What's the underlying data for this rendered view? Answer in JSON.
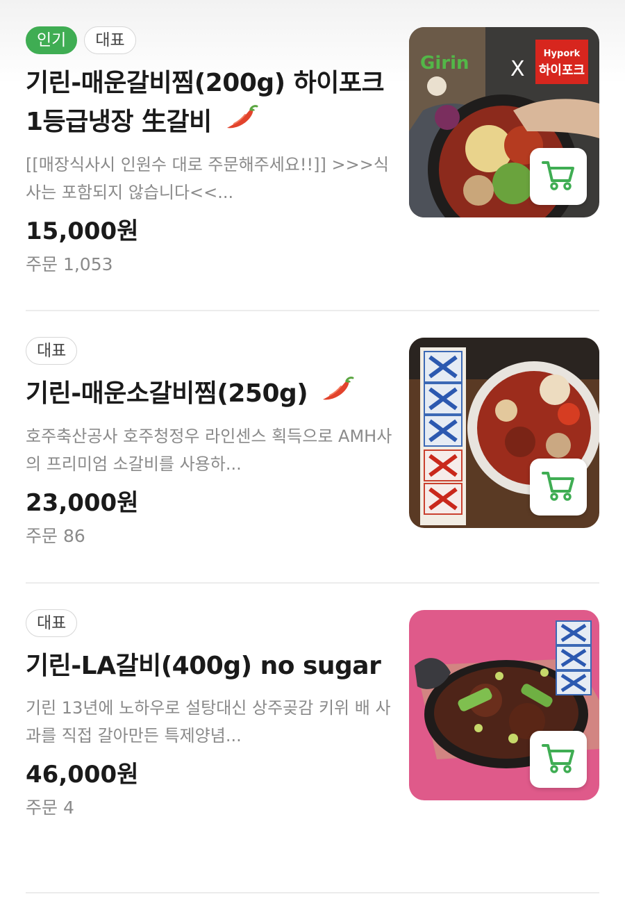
{
  "colors": {
    "accent": "#3fad53",
    "title": "#1a1a1a",
    "muted": "#8a8a8a",
    "divider": "#ececec"
  },
  "items": [
    {
      "badges": [
        "인기",
        "대표"
      ],
      "title": "기린-매운갈비찜(200g) 하이포크1등급냉장 生갈비",
      "spicy": true,
      "description": "[[매장식사시 인원수 대로 주문해주세요!!]] >>>식사는 포함되지 않습니다<<...",
      "price": "15,000원",
      "orders": "주문 1,053",
      "image_logo_left": "Girin",
      "image_logo_x": "X",
      "image_logo_brand_en": "Hypork",
      "image_logo_brand_ko": "하이포크",
      "icon": "cart-icon"
    },
    {
      "badges": [
        "대표"
      ],
      "title": "기린-매운소갈비찜(250g)",
      "spicy": true,
      "description": "호주축산공사 호주청정우 라인센스 획득으로 AMH사의 프리미엄 소갈비를 사용하...",
      "price": "23,000원",
      "orders": "주문 86",
      "icon": "cart-icon"
    },
    {
      "badges": [
        "대표"
      ],
      "title": "기린-LA갈비(400g) no sugar",
      "spicy": false,
      "description": "기린 13년에 노하우로 설탕대신 상주곶감 키위 배 사과를 직접 갈아만든 특제양념...",
      "price": "46,000원",
      "orders": "주문 4",
      "icon": "cart-icon"
    }
  ]
}
